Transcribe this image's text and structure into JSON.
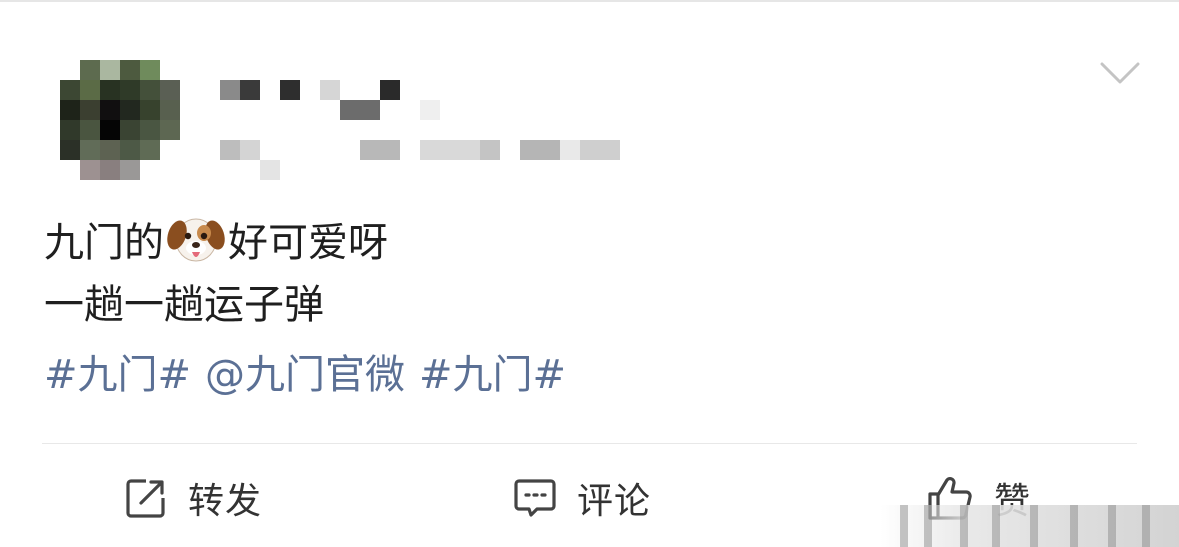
{
  "post": {
    "line1_before": "九门的",
    "line1_emoji": "dog-face-emoji",
    "line1_after": "好可爱呀",
    "line2": "一趟一趟运子弹",
    "hashtag1": "#九门#",
    "mention": "@九门官微",
    "hashtag2": "#九门#"
  },
  "actions": {
    "repost_label": "转发",
    "comment_label": "评论",
    "like_label": "赞"
  },
  "colors": {
    "link": "#5b7095",
    "text": "#1f1f1f",
    "action_text": "#333333",
    "divider": "#e8e8e8",
    "chevron": "#c4c4c4"
  },
  "icons": {
    "more": "chevron-down-icon",
    "repost": "share-icon",
    "comment": "comment-icon",
    "like": "thumbs-up-icon"
  }
}
